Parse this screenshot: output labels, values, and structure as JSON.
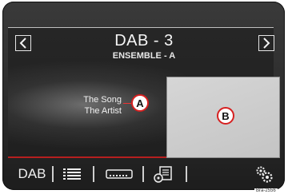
{
  "header": {
    "station": "DAB - 3",
    "ensemble": "ENSEMBLE - A"
  },
  "now_playing": {
    "song": "The Song",
    "artist": "The Artist"
  },
  "callouts": {
    "a": "A",
    "b": "B"
  },
  "bottom_bar": {
    "source_label": "DAB",
    "icons": [
      "list-icon",
      "presets-icon",
      "memory-card-icon",
      "settings-icon"
    ]
  },
  "reference_code": "Bra-2556",
  "colors": {
    "bezel": "#2b2b2b",
    "accent_line": "#b61f1f",
    "callout_ring": "#d62020",
    "album_art_placeholder": "#cfcfcf"
  }
}
